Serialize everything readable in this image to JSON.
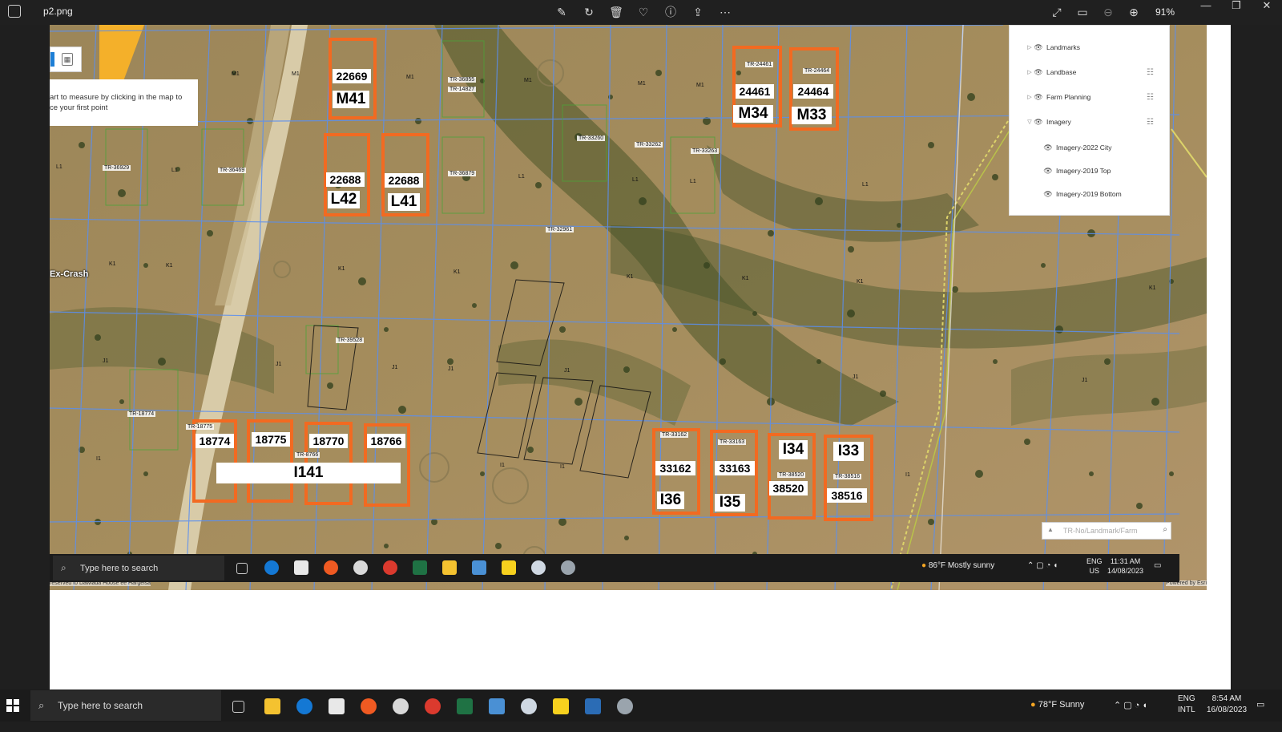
{
  "viewer": {
    "file_name": "p2.png",
    "zoom": "91%",
    "tools": [
      "edit-icon",
      "rotate-icon",
      "delete-icon",
      "heart-icon",
      "info-icon",
      "share-icon",
      "more-icon"
    ]
  },
  "map": {
    "measure_hint_line1": "art to measure by clicking in the map to",
    "measure_hint_line2": "ce your first point",
    "ex_crash": "Ex-Crash",
    "search_placeholder": "TR-No/Landmark/Farm",
    "attribution_left": "reserved to Dawlada Hoose ee Hargeisa",
    "attribution_right": "Powered by Esri",
    "layers": [
      {
        "name": "Landmarks",
        "expanded": false,
        "options": false
      },
      {
        "name": "Landbase",
        "expanded": false,
        "options": true
      },
      {
        "name": "Farm Planning",
        "expanded": false,
        "options": true
      },
      {
        "name": "Imagery",
        "expanded": true,
        "options": true
      },
      {
        "name": "Imagery-2022 City",
        "child": true
      },
      {
        "name": "Imagery-2019 Top",
        "child": true
      },
      {
        "name": "Imagery-2019 Bottom",
        "child": true
      }
    ],
    "parcels": {
      "p22669": "22669",
      "m41": "M41",
      "p24461": "24461",
      "m34": "M34",
      "tr24461": "TR-24461",
      "p24464": "24464",
      "m33": "M33",
      "tr24464": "TR-24464",
      "p22688a": "22688",
      "l42": "L42",
      "p22688b": "22688",
      "l41": "L41",
      "p18774": "18774",
      "p18775": "18775",
      "p18770": "18770",
      "p18766": "18766",
      "i141": "I141",
      "p33162": "33162",
      "i36": "I36",
      "tr33162": "TR-33162",
      "p33163": "33163",
      "i35": "I35",
      "tr33163": "TR-33163",
      "i34": "I34",
      "p38520": "38520",
      "tr38520": "TR-38520",
      "i33": "I33",
      "p38516": "38516",
      "tr38516": "TR-38516"
    },
    "tr_labels": {
      "t36855": "TR-36855",
      "t14827": "TR-14827",
      "t33260": "TR-33260",
      "t33262": "TR-33262",
      "t33263": "TR-33263",
      "t36929": "TR-36929",
      "t36469": "TR-36469",
      "t36879": "TR-36879",
      "t32961": "TR-32961",
      "t39528": "TR-39528",
      "t18774": "TR-18774",
      "t18775": "TR-18775",
      "t8766": "TR-8766"
    },
    "grid_letters": {
      "m": "M1",
      "l": "L1",
      "k": "K1",
      "j": "J1",
      "i": "I1"
    }
  },
  "inner_taskbar": {
    "search_text": "Type here to search",
    "weather": "86°F  Mostly sunny",
    "lang1": "ENG",
    "lang2": "US",
    "time": "11:31 AM",
    "date": "14/08/2023"
  },
  "outer_taskbar": {
    "search_text": "Type here to search",
    "weather": "78°F  Sunny",
    "lang1": "ENG",
    "lang2": "INTL",
    "time": "8:54 AM",
    "date": "16/08/2023"
  }
}
